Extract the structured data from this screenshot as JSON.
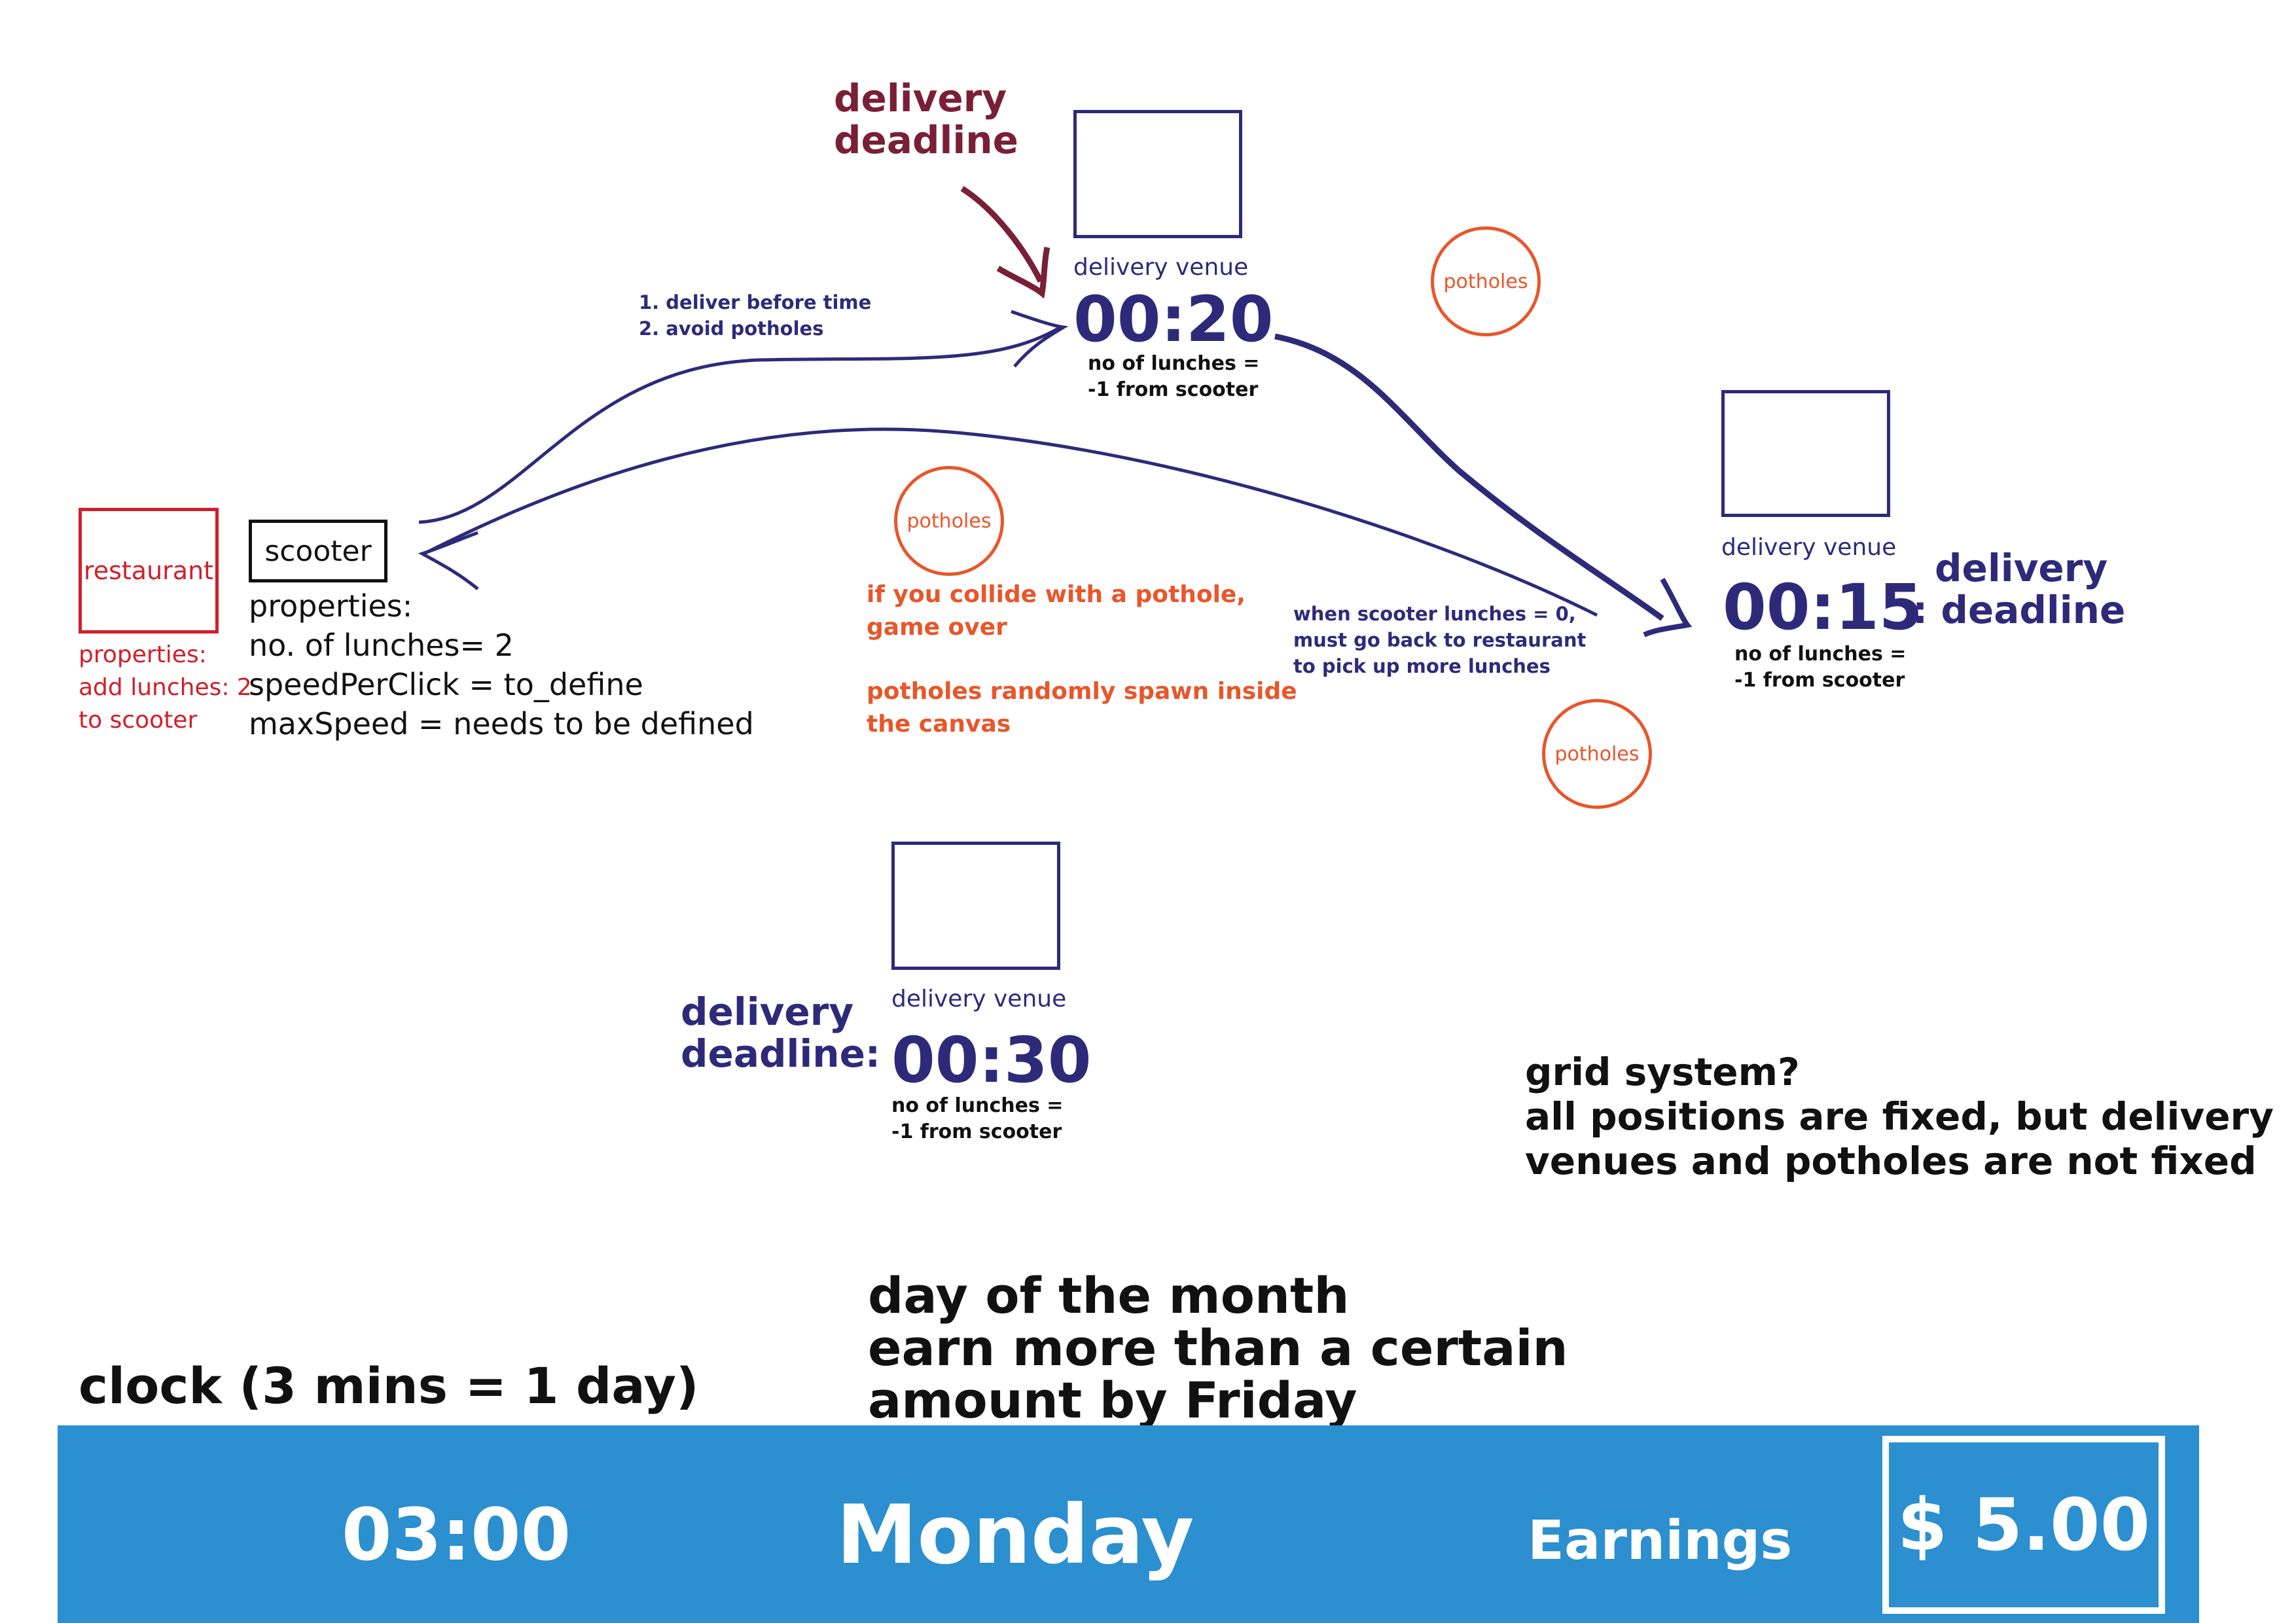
{
  "top_deadline": {
    "line1": "delivery",
    "line2": "deadline"
  },
  "right_deadline": {
    "line1": "delivery",
    "line2": ": deadline"
  },
  "bottom_deadline": {
    "line1": "delivery",
    "line2": "deadline:"
  },
  "venues": [
    {
      "label": "delivery venue",
      "time": "00:20",
      "note1": "no of lunches =",
      "note2": "-1 from scooter"
    },
    {
      "label": "delivery venue",
      "time": "00:15",
      "note1": "no of lunches =",
      "note2": "-1 from scooter"
    },
    {
      "label": "delivery venue",
      "time": "00:30",
      "note1": "no of lunches =",
      "note2": "-1 from scooter"
    }
  ],
  "potholes": [
    "potholes",
    "potholes",
    "potholes"
  ],
  "arrow_note": {
    "line1": "1. deliver before time",
    "line2": "2. avoid potholes"
  },
  "pothole_notes": {
    "collide1": "if you collide with a pothole,",
    "collide2": "game over",
    "spawn1": "potholes randomly spawn inside",
    "spawn2": "the canvas"
  },
  "return_note": {
    "line1": "when scooter lunches = 0,",
    "line2": "must go back to restaurant",
    "line3": "to pick up more lunches"
  },
  "restaurant": {
    "label": "restaurant",
    "prop1": "properties:",
    "prop2": "add lunches: 2",
    "prop3": "to scooter"
  },
  "scooter": {
    "label": "scooter",
    "prop1": "properties:",
    "prop2": "no. of lunches= 2",
    "prop3": "speedPerClick = to_define",
    "prop4": "maxSpeed = needs to be defined"
  },
  "grid_note": {
    "line1": "grid system?",
    "line2": "all positions are fixed, but delivery",
    "line3": "venues and potholes are not fixed"
  },
  "day_note": {
    "line1": "day of the month",
    "line2": "earn more than a certain",
    "line3": "amount by Friday"
  },
  "clock_note": "clock (3 mins = 1 day)",
  "hud": {
    "clock": "03:00",
    "day": "Monday",
    "earnings_label": "Earnings",
    "earnings_value": "$ 5.00"
  },
  "colors": {
    "venue": "#2e2a7a",
    "deadline_red": "#7a1f38",
    "pothole": "#e8562a",
    "restaurant": "#d21e2a",
    "hud": "#2b8fd0"
  }
}
